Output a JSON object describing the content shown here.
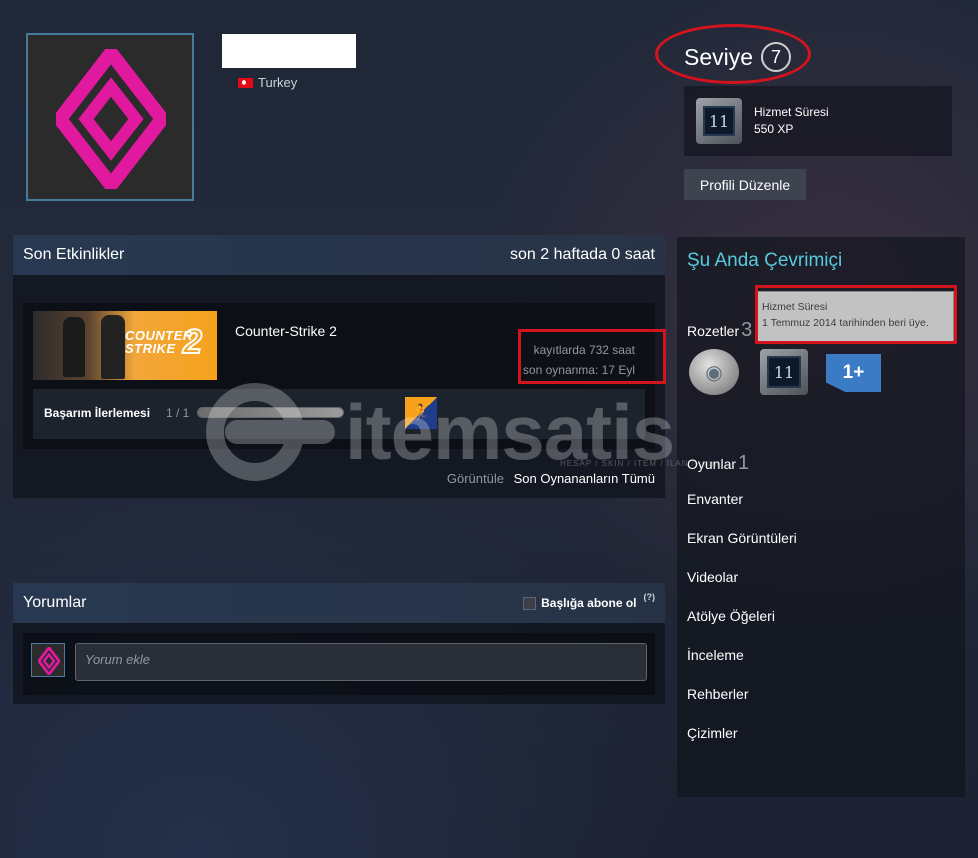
{
  "profile": {
    "country": "Turkey",
    "level_label": "Seviye",
    "level_value": "7",
    "featured_badge": {
      "title": "Hizmet Süresi",
      "xp": "550 XP",
      "icon_text": "11"
    },
    "edit_button": "Profili Düzenle"
  },
  "activity": {
    "title": "Son Etkinlikler",
    "summary": "son 2 haftada 0 saat",
    "game": {
      "name": "Counter-Strike 2",
      "art_logo_line1": "COUNTER",
      "art_logo_line2": "STRIKE",
      "art_logo_number": "2",
      "hours_on_record": "kayıtlarda 732 saat",
      "last_played": "son oynanma: 17 Eyl",
      "achievement_label": "Başarım İlerlemesi",
      "achievement_count": "1 / 1",
      "achievement_progress": 1.0
    },
    "view_label": "Görüntüle",
    "view_link": "Son Oynananların Tümü"
  },
  "comments": {
    "title": "Yorumlar",
    "subscribe_label": "Başlığa abone ol",
    "help_mark": "(?)",
    "input_placeholder": "Yorum ekle"
  },
  "sidebar": {
    "status": "Şu Anda Çevrimiçi",
    "badges_label": "Rozetler",
    "badges_count": "3",
    "badge_years_text": "11",
    "badge_plus_text": "1+",
    "tooltip_title": "Hizmet Süresi",
    "tooltip_text": "1 Temmuz 2014 tarihinden beri üye.",
    "links": {
      "games": "Oyunlar",
      "games_count": "1",
      "inventory": "Envanter",
      "screenshots": "Ekran Görüntüleri",
      "videos": "Videolar",
      "workshop": "Atölye Öğeleri",
      "reviews": "İnceleme",
      "guides": "Rehberler",
      "artwork": "Çizimler"
    }
  },
  "watermark": {
    "text": "itemsatis",
    "subtext": "HESAP / SKIN / ITEM / İLAN / .com"
  },
  "colors": {
    "accent_online": "#57cbde",
    "highlight": "#d3141c",
    "avatar_magenta": "#e0199f"
  }
}
